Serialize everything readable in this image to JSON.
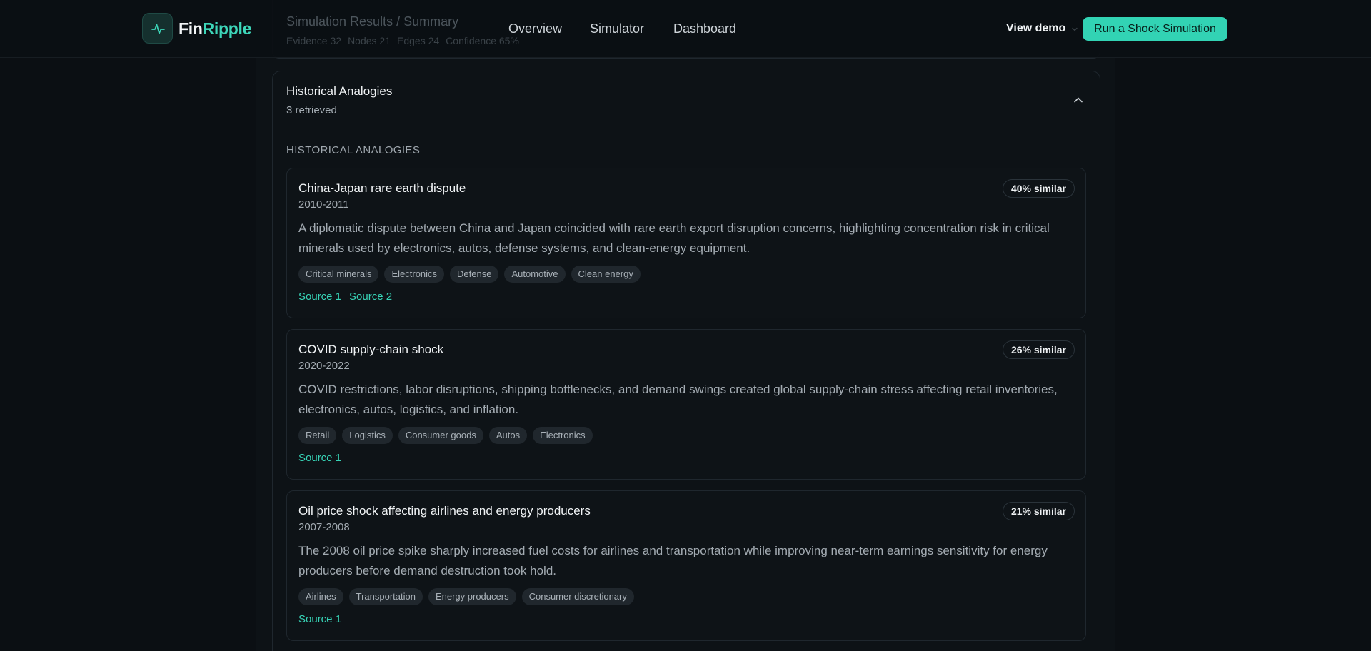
{
  "header": {
    "brand_part1": "Fin",
    "brand_part2": "Ripple",
    "breadcrumb": "Simulation Results / Summary",
    "meta": [
      "Evidence 32",
      "Nodes 21",
      "Edges 24",
      "Confidence 65%"
    ],
    "nav": [
      "Overview",
      "Simulator",
      "Dashboard"
    ],
    "demo_label": "View demo",
    "cta_label": "Run a Shock Simulation"
  },
  "panel": {
    "title": "Historical Analogies",
    "subtitle": "3 retrieved",
    "section_label": "HISTORICAL ANALOGIES",
    "cards": [
      {
        "title": "China-Japan rare earth dispute",
        "years": "2010-2011",
        "similarity": "40% similar",
        "description": "A diplomatic dispute between China and Japan coincided with rare earth export disruption concerns, highlighting concentration risk in critical minerals used by electronics, autos, defense systems, and clean-energy equipment.",
        "tags": [
          "Critical minerals",
          "Electronics",
          "Defense",
          "Automotive",
          "Clean energy"
        ],
        "sources": [
          "Source 1",
          "Source 2"
        ]
      },
      {
        "title": "COVID supply-chain shock",
        "years": "2020-2022",
        "similarity": "26% similar",
        "description": "COVID restrictions, labor disruptions, shipping bottlenecks, and demand swings created global supply-chain stress affecting retail inventories, electronics, autos, logistics, and inflation.",
        "tags": [
          "Retail",
          "Logistics",
          "Consumer goods",
          "Autos",
          "Electronics"
        ],
        "sources": [
          "Source 1"
        ]
      },
      {
        "title": "Oil price shock affecting airlines and energy producers",
        "years": "2007-2008",
        "similarity": "21% similar",
        "description": "The 2008 oil price spike sharply increased fuel costs for airlines and transportation while improving near-term earnings sensitivity for energy producers before demand destruction took hold.",
        "tags": [
          "Airlines",
          "Transportation",
          "Energy producers",
          "Consumer discretionary"
        ],
        "sources": [
          "Source 1"
        ]
      }
    ]
  },
  "colors": {
    "accent": "#32d3b4",
    "background": "#0b0f13",
    "card": "#0e1317"
  },
  "icons": {
    "logo": "activity-pulse-icon",
    "collapse": "chevron-up-icon",
    "demo_dropdown": "chevron-down-icon"
  }
}
